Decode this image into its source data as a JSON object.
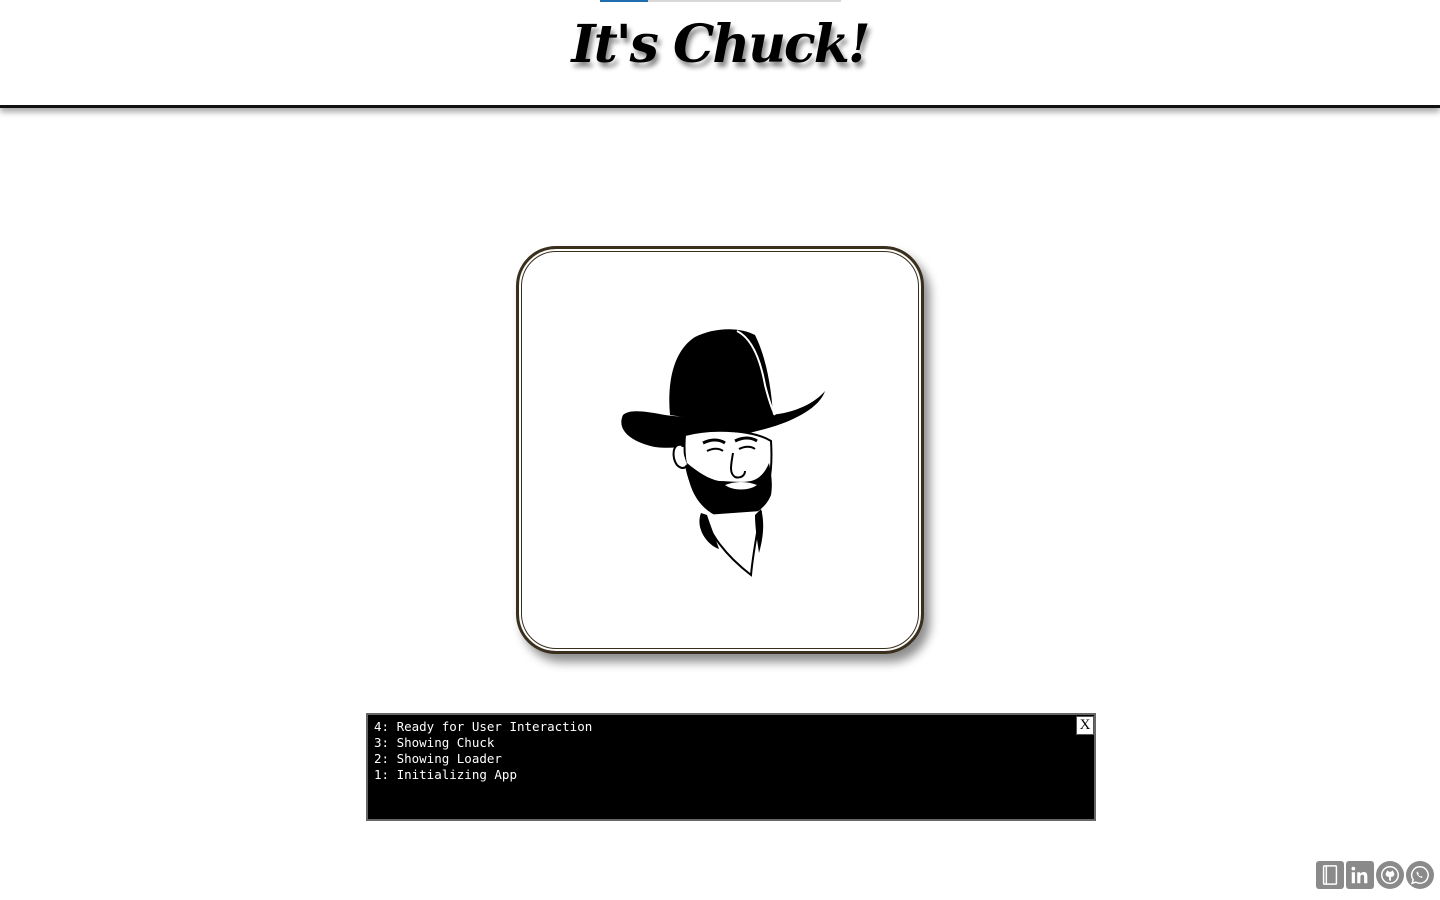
{
  "header": {
    "title": "It's Chuck!",
    "progress_fraction": 0.2
  },
  "log": {
    "lines": [
      "4: Ready for User Interaction",
      "3: Showing Chuck",
      "2: Showing Loader",
      "1: Initializing App"
    ],
    "close_label": "X"
  },
  "social": [
    {
      "name": "blog",
      "icon": "book-icon"
    },
    {
      "name": "linkedin",
      "icon": "linkedin-icon"
    },
    {
      "name": "github",
      "icon": "github-icon"
    },
    {
      "name": "whatsapp",
      "icon": "whatsapp-icon"
    }
  ],
  "colors": {
    "header_border": "#111111",
    "progress": "#1f6fb0",
    "log_background": "#000000",
    "social_gray": "#8a8a8a"
  }
}
